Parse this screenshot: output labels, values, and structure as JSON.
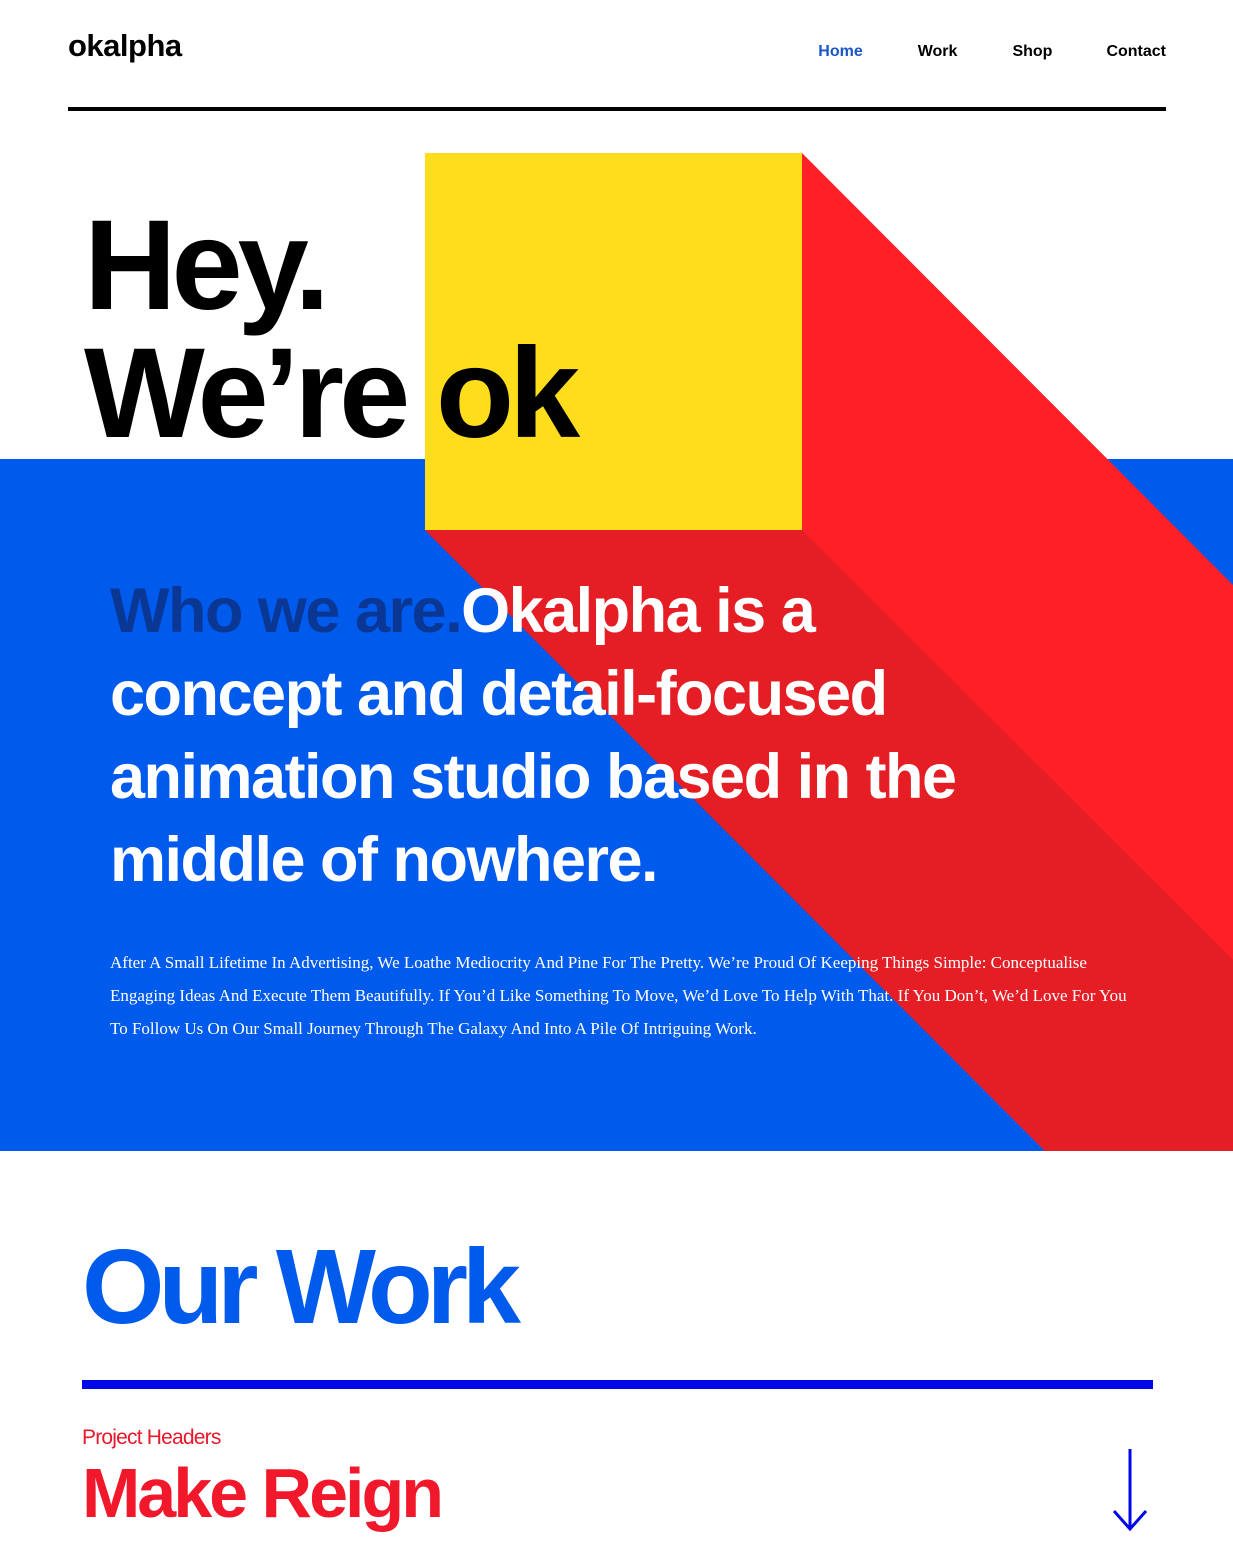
{
  "header": {
    "logo": "okalpha",
    "nav": [
      {
        "label": "Home",
        "active": true
      },
      {
        "label": "Work",
        "active": false
      },
      {
        "label": "Shop",
        "active": false
      },
      {
        "label": "Contact",
        "active": false
      }
    ]
  },
  "hero": {
    "title_line_1": "Hey.",
    "title_line_2": "We’re ok",
    "intro_lead": "Who we are.",
    "intro_text": "Okalpha is a concept and detail-focused animation studio based in the middle of nowhere.",
    "body": "After A Small Lifetime In Advertising, We Loathe Mediocrity And Pine For The Pretty. We’re Proud Of Keeping Things Simple: Conceptualise Engaging Ideas And Execute Them Beautifully. If You’d Like Something To Move, We’d Love To Help With That. If You Don’t, We’d Love For You To Follow Us On Our Small Journey Through The Galaxy And Into A Pile Of Intriguing Work."
  },
  "work": {
    "title": "Our Work",
    "project_label": "Project Headers",
    "project_title": "Make Reign",
    "arrow_icon": "arrow-down-icon"
  },
  "colors": {
    "blue": "#005aeb",
    "yellow": "#fddd1c",
    "red": "#ff1f26",
    "red_shadow": "#e51e25",
    "nav_active": "#1a56c8",
    "rule_blue": "#0008e8",
    "project_red": "#f0182a"
  }
}
